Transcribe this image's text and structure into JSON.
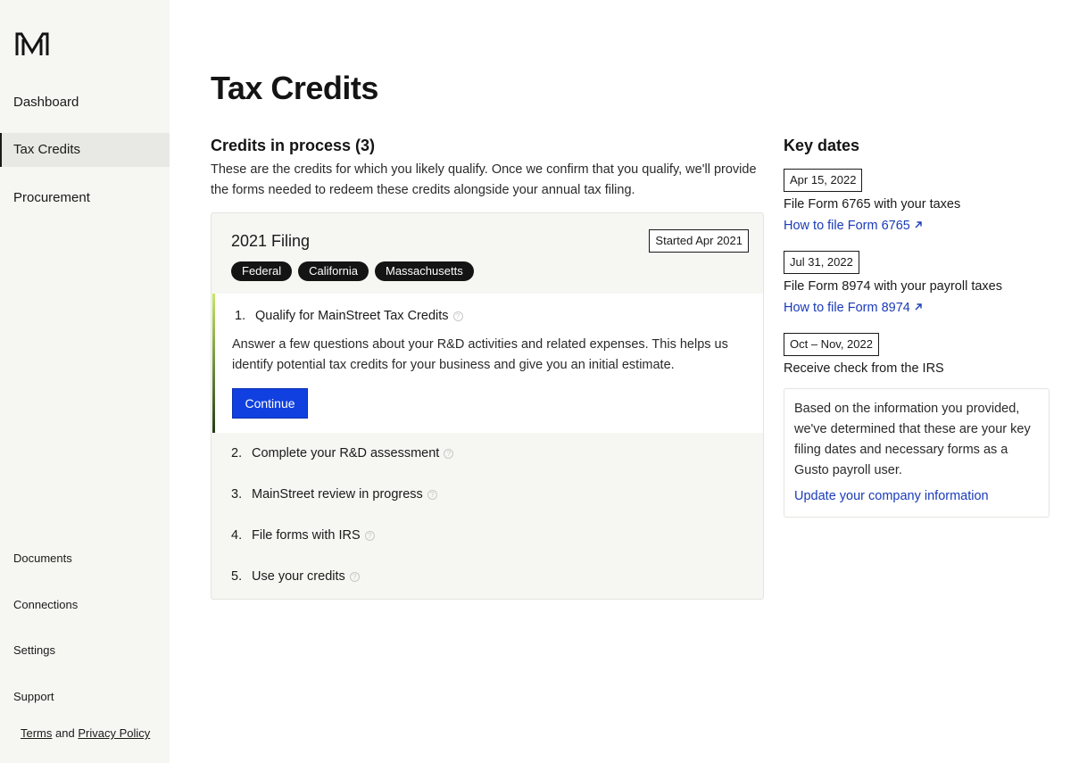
{
  "sidebar": {
    "logo": "M",
    "nav": [
      {
        "label": "Dashboard"
      },
      {
        "label": "Tax Credits",
        "active": true
      },
      {
        "label": "Procurement"
      }
    ],
    "bottom": [
      {
        "label": "Documents"
      },
      {
        "label": "Connections"
      },
      {
        "label": "Settings"
      },
      {
        "label": "Support"
      }
    ],
    "legal": {
      "terms": "Terms",
      "and": "and",
      "privacy": "Privacy Policy"
    }
  },
  "main": {
    "title": "Tax Credits",
    "section_title": "Credits in process (3)",
    "intro": "These are the credits for which you likely qualify. Once we confirm that you qualify, we'll provide the forms needed to redeem these credits alongside your annual tax filing.",
    "filing": {
      "title": "2021 Filing",
      "started": "Started Apr 2021",
      "tags": [
        "Federal",
        "California",
        "Massachusetts"
      ],
      "steps": [
        {
          "num": "1.",
          "label": "Qualify for MainStreet Tax Credits",
          "desc": "Answer a few questions about your R&D activities and related expenses. This helps us identify potential tax credits for your business and give you an initial estimate.",
          "button": "Continue"
        },
        {
          "num": "2.",
          "label": "Complete your R&D assessment"
        },
        {
          "num": "3.",
          "label": "MainStreet review in progress"
        },
        {
          "num": "4.",
          "label": "File forms with IRS"
        },
        {
          "num": "5.",
          "label": "Use your credits"
        }
      ]
    }
  },
  "key_dates": {
    "title": "Key dates",
    "items": [
      {
        "date": "Apr 15, 2022",
        "text": "File Form 6765 with your taxes",
        "link": "How to file Form 6765"
      },
      {
        "date": "Jul 31, 2022",
        "text": "File Form 8974 with your payroll taxes",
        "link": "How to file Form 8974"
      },
      {
        "date": "Oct – Nov, 2022",
        "text": "Receive check from the IRS"
      }
    ],
    "info": "Based on the information you provided, we've determined that these are your key filing dates and necessary forms as a Gusto payroll user.",
    "info_link": "Update your company information"
  },
  "colors": {
    "accent": "#1040e0",
    "link": "#1a3bb8",
    "sidebar_bg": "#f6f6f3"
  },
  "icons": {
    "help": "question-circle-icon",
    "external": "arrow-up-right-icon"
  }
}
